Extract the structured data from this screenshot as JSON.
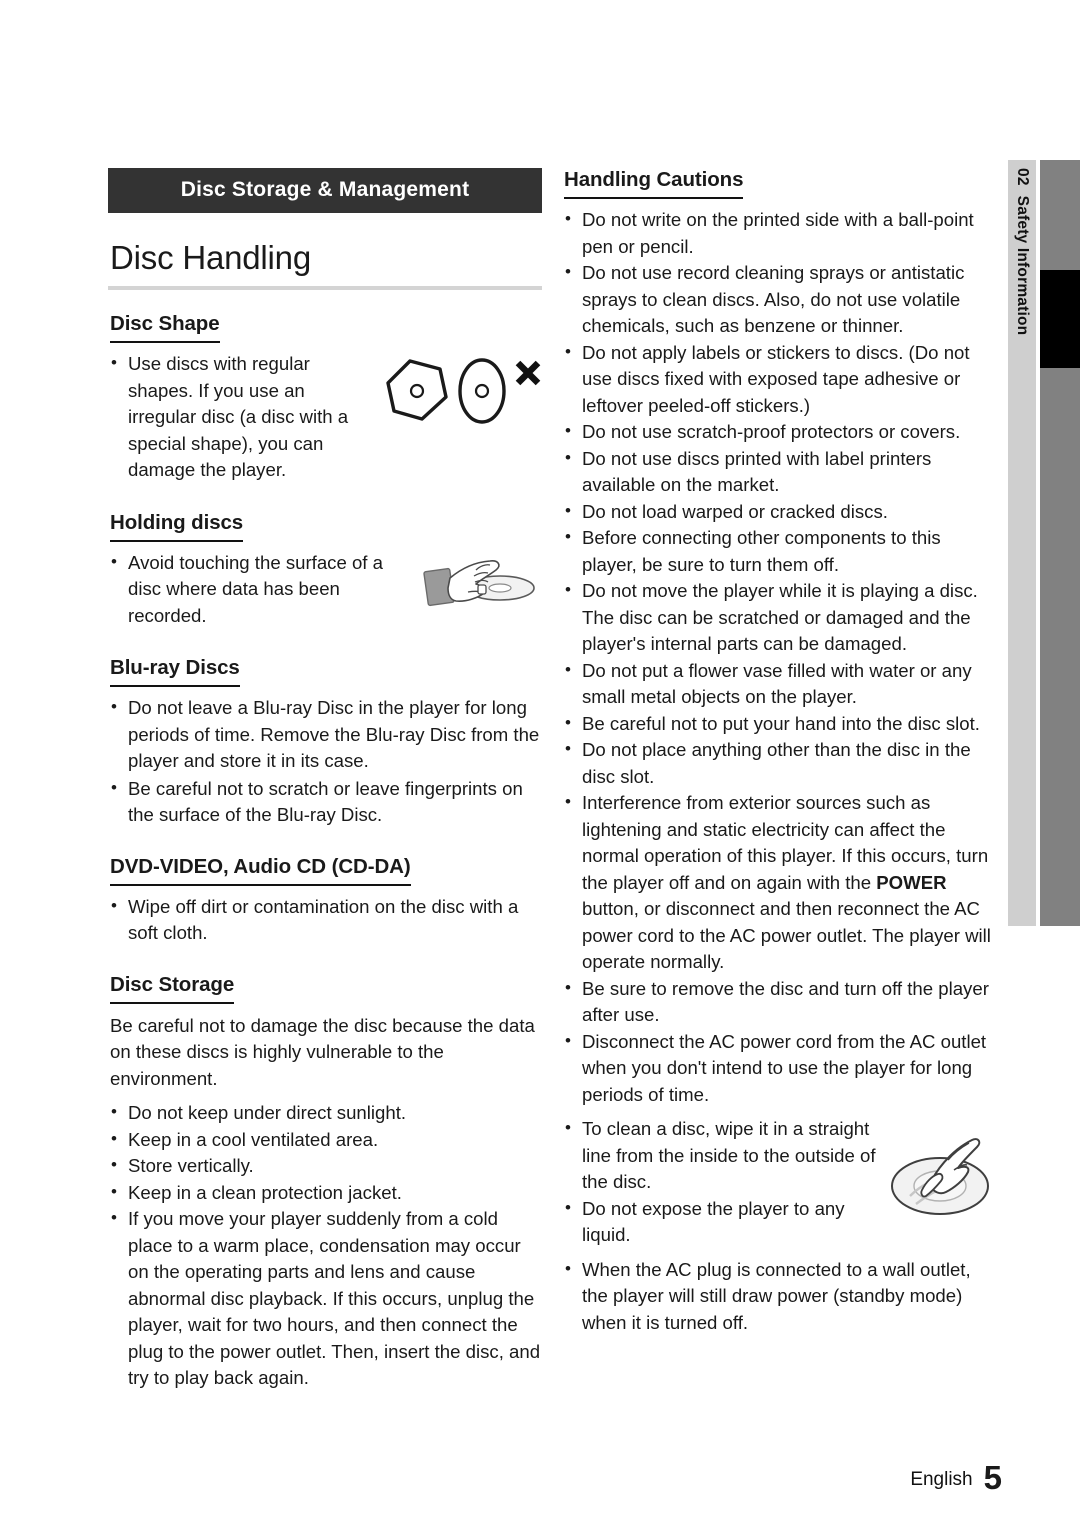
{
  "banner": {
    "title": "Disc Storage & Management"
  },
  "chapter": {
    "title": "Disc Handling"
  },
  "side_tab": {
    "number": "02",
    "label": "Safety Information"
  },
  "footer": {
    "language": "English",
    "page_number": "5"
  },
  "icons": {
    "hexagon_disc": "hexagon-disc-icon",
    "oval_disc": "oval-disc-icon",
    "forbidden_x": "x-mark-icon",
    "hand_holding_disc": "hand-holding-disc-illustration",
    "hand_wiping_disc": "hand-wiping-disc-illustration"
  },
  "colors": {
    "banner_bg": "#333333",
    "banner_text": "#ffffff",
    "chapter_rule": "#d4d4d4",
    "side_tab_bg": "#cfcfcf",
    "side_bar_bg": "#818181",
    "side_bar_active": "#000000",
    "body_text": "#1a1a1a"
  },
  "left_column": {
    "sections": [
      {
        "heading": "Disc Shape",
        "bullets": [
          "Use discs with regular shapes. If you use an irregular disc (a disc with a special shape), you can damage the player."
        ]
      },
      {
        "heading": "Holding discs",
        "bullets": [
          "Avoid touching the surface of a disc where data has been recorded."
        ]
      },
      {
        "heading": "Blu-ray Discs",
        "bullets": [
          "Do not leave a Blu-ray Disc in the player for long periods of time. Remove the Blu-ray Disc from the player and store it in its case.",
          "Be careful not to scratch or leave fingerprints on the surface of the Blu-ray Disc."
        ]
      },
      {
        "heading": "DVD-VIDEO, Audio CD (CD-DA)",
        "bullets": [
          "Wipe off dirt or contamination on the disc with a soft cloth."
        ]
      },
      {
        "heading": "Disc Storage",
        "paragraph": "Be careful not to damage the disc because the data on these discs is highly vulnerable to the environment.",
        "bullets": [
          "Do not keep under direct sunlight.",
          "Keep in a cool ventilated area.",
          "Store vertically.",
          "Keep in a clean protection jacket.",
          "If you move your player suddenly from a cold place to a warm place, condensation may occur on the operating parts and lens and cause abnormal disc playback. If this occurs, unplug the player, wait for two hours, and then connect the plug to the power outlet. Then, insert the disc, and try to play back again."
        ]
      }
    ]
  },
  "right_column": {
    "heading": "Handling Cautions",
    "bullets": [
      "Do not write on the printed side with a ball-point pen or pencil.",
      "Do not use record cleaning sprays or antistatic sprays to clean discs. Also, do not use volatile chemicals, such as benzene or thinner.",
      "Do not apply labels or stickers to discs. (Do not use discs fixed with exposed tape adhesive or leftover peeled-off stickers.)",
      "Do not use scratch-proof protectors or covers.",
      "Do not use discs printed with label printers available on the market.",
      "Do not load warped or cracked discs.",
      "Before connecting other components to this player, be sure to turn them off.",
      "Do not move the player while it is playing a disc. The disc can be scratched or damaged and the player's internal parts can be damaged.",
      "Do not put a flower vase filled with water or any small metal objects on the player.",
      "Be careful not to put your hand into the disc slot.",
      "Do not place anything other than the disc in the disc slot."
    ],
    "interference_bullet": {
      "text_before": "Interference from exterior sources such as lightening and static electricity can affect the normal operation of this player. If this occurs, turn the player off and on again with the ",
      "bold_term": "POWER",
      "text_after": " button, or disconnect and then reconnect the AC power cord to the AC power outlet. The player will operate normally."
    },
    "bullets_after": [
      "Be sure to remove the disc and turn off the player after use.",
      "Disconnect the AC power cord from the AC outlet when you don't intend to use the player for long periods of time.",
      "To clean a disc, wipe it in a straight line from the inside to the outside of the disc.",
      "Do not expose the player to any liquid.",
      "When the AC plug is connected to a wall outlet, the player will still draw power (standby mode) when it is turned off."
    ]
  }
}
